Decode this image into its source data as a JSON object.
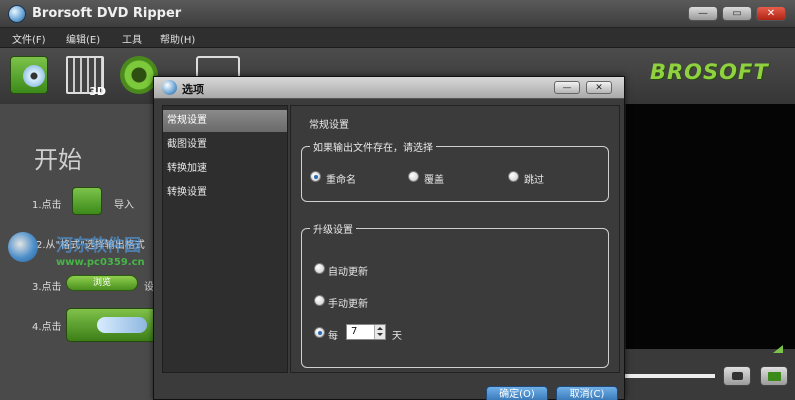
{
  "window": {
    "title": "Brorsoft DVD Ripper",
    "min_label": "—",
    "max_label": "▭",
    "close_label": "✕"
  },
  "menu": [
    "文件(F)",
    "编辑(E)",
    "工具",
    "帮助(H)"
  ],
  "toolbar": {
    "icons": [
      "dvd-load-icon",
      "film-3d-icon",
      "gear-icon",
      "misc-icon"
    ],
    "film_badge": "3D",
    "logo": "BROSOFT"
  },
  "left_panel": {
    "title": "开始",
    "step1_label": "1.点击",
    "step1_text": "导入",
    "step2_label": "2.从\"格式\"选择输出格式",
    "step3_label": "3.点击",
    "step3_button": "浏览",
    "step3_text": "设",
    "step4_label": "4.点击"
  },
  "watermark": {
    "text": "河东软件园",
    "url": "www.pc0359.cn"
  },
  "dialog": {
    "title": "选项",
    "nav": [
      "常规设置",
      "截图设置",
      "转换加速",
      "转换设置"
    ],
    "active_nav": 0,
    "content": {
      "section_title": "常规设置",
      "group1_title": "如果输出文件存在，请选择",
      "group1_options": [
        "重命名",
        "覆盖",
        "跳过"
      ],
      "group1_selected": 0,
      "group2_title": "升级设置",
      "group2_options": [
        "自动更新",
        "手动更新",
        "每"
      ],
      "group2_selected": 2,
      "interval_value": "7",
      "interval_unit": "天"
    },
    "ok_label": "确定(O)",
    "cancel_label": "取消(C)"
  },
  "colors": {
    "accent_green": "#7cc34a",
    "preview_bg": "#050505",
    "dialog_button_blue": "#2f6fb0"
  }
}
